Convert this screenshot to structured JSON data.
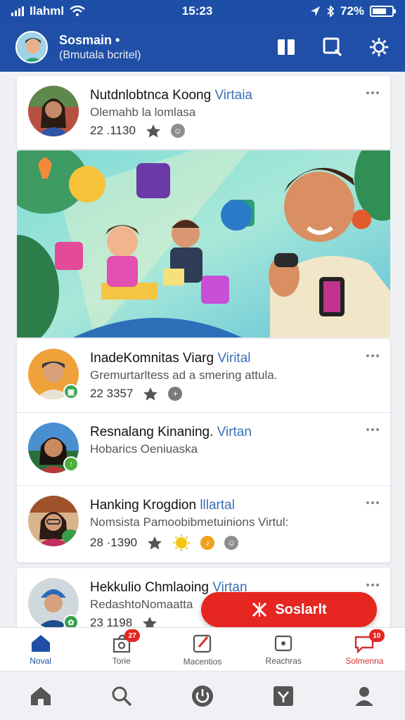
{
  "status_bar": {
    "carrier": "Ilahml",
    "time": "15:23",
    "battery": "72%",
    "battery_level": 0.72
  },
  "header": {
    "title": "Sosmain •",
    "subtitle": "(Bmutala bcritel)"
  },
  "feed": [
    {
      "name": "Nutdnlobtnca Koong",
      "tag": "Virtaia",
      "subtitle": "Olemahb la lomlasa",
      "meta": "22 .1130"
    },
    {
      "name": "InadeKomnitas Viarg",
      "tag": "Virital",
      "subtitle": "Gremurtarltess ad a smering attula.",
      "meta": "22 3357"
    },
    {
      "name": "Resnalang Kinaning.",
      "tag": "Virtan",
      "subtitle": "Hobarics Oeniuaska",
      "meta": ""
    },
    {
      "name": "Hanking Krogdion",
      "tag": "lllartal",
      "subtitle": "Nomsista Pamoobibmetuinions Virtul:",
      "meta": "28 ·1390"
    },
    {
      "name": "Hekkulio Chmlaoing",
      "tag": "Virtan",
      "subtitle": "RedashtoNomaatta",
      "meta": "23 1198"
    }
  ],
  "fab": {
    "label": "Soslarlt"
  },
  "tabs": [
    {
      "label": "Noval",
      "badge": ""
    },
    {
      "label": "Torie",
      "badge": "27"
    },
    {
      "label": "Macentios",
      "badge": ""
    },
    {
      "label": "Reachras",
      "badge": ""
    },
    {
      "label": "Solmenna",
      "badge": "10"
    }
  ],
  "colors": {
    "primary": "#1f4fa6",
    "accent_red": "#e52621",
    "link_blue": "#3a6fb5"
  }
}
